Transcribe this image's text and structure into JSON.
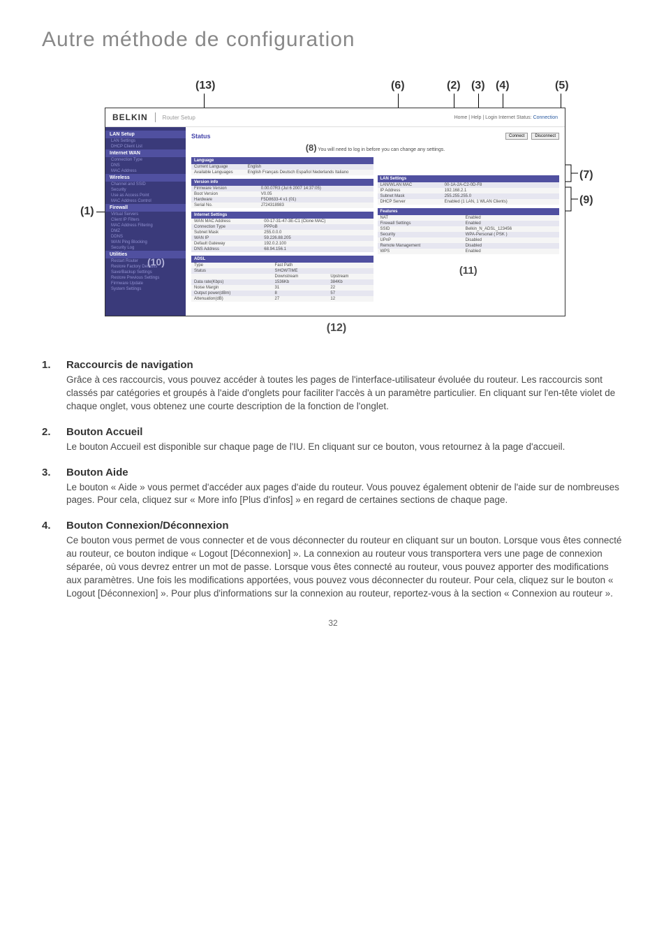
{
  "page_title": "Autre méthode de configuration",
  "callouts": {
    "c1": "(1)",
    "c2": "(2)",
    "c3": "(3)",
    "c4": "(4)",
    "c5": "(5)",
    "c6": "(6)",
    "c7": "(7)",
    "c8": "(8)",
    "c9": "(9)",
    "c10": "(10)",
    "c11": "(11)",
    "c12": "(12)",
    "c13": "(13)"
  },
  "router_ui": {
    "logo": "BELKIN",
    "setup_label": "Router Setup",
    "header_links": "Home | Help | Login   Internet Status:",
    "header_status": "Connection",
    "status_label": "Status",
    "connect_btn": "Connect",
    "disconnect_btn": "Disconnect",
    "login_note_prefix": "You will need to log in before you can change any settings.",
    "sidebar": {
      "lan_setup": "LAN Setup",
      "lan_settings": "LAN Settings",
      "dhcp_client_list": "DHCP Client List",
      "internet_wan": "Internet WAN",
      "connection_type": "Connection Type",
      "dns": "DNS",
      "mac_address": "MAC Address",
      "wireless": "Wireless",
      "channel_ssid": "Channel and SSID",
      "security": "Security",
      "use_as_ap": "Use as Access Point",
      "mac_addr_control": "MAC Address Control",
      "firewall": "Firewall",
      "virtual_servers": "Virtual Servers",
      "client_ip_filters": "Client IP Filters",
      "mac_addr_filtering": "MAC Address Filtering",
      "dmz": "DMZ",
      "ddns": "DDNS",
      "wan_ping_blocking": "WAN Ping Blocking",
      "security_log": "Security Log",
      "utilities": "Utilities",
      "restart_router": "Restart Router",
      "restore_factory": "Restore Factory Defaults",
      "save_backup": "Save/Backup Settings",
      "restore_previous": "Restore Previous Settings",
      "firmware_update": "Firmware Update",
      "system_settings": "System Settings"
    },
    "tables": {
      "language_hdr": "Language",
      "current_language_lbl": "Current Language",
      "current_language_val": "English",
      "available_languages_lbl": "Available Languages",
      "available_languages_val": "English Français Deutsch Español Nederlands Italiano",
      "version_hdr": "Version info",
      "firmware_version_lbl": "Firmware Version",
      "firmware_version_val": "0.00.07R3 (Jul 6 2007 14:37:05)",
      "boot_version_lbl": "Boot Version",
      "boot_version_val": "V0.05",
      "hardware_lbl": "Hardware",
      "hardware_val": "F5D8633-4 v1 (01)",
      "serial_lbl": "Serial No.",
      "serial_val": "J724318983",
      "internet_hdr": "Internet Settings",
      "wan_mac_lbl": "WAN MAC Address",
      "wan_mac_val": "00-17-31-47-3E-C1 (Clone MAC)",
      "connection_type_lbl": "Connection Type",
      "connection_type_val": "PPPoB",
      "subnet_mask_lbl": "Subnet Mask",
      "subnet_mask_val": "255.0.0.0",
      "wan_ip_lbl": "WAN IP",
      "wan_ip_val": "59.226.88.205",
      "default_gw_lbl": "Default Gateway",
      "default_gw_val": "192.0.2.100",
      "dns_addr_lbl": "DNS Address",
      "dns_addr_val": "68.94.156.1",
      "adsl_hdr": "ADSL",
      "adsl_type_lbl": "Type",
      "adsl_type_val": "Fast Path",
      "adsl_status_lbl": "Status",
      "adsl_status_val": "SHOWTIME",
      "adsl_downstream": "Downstream",
      "adsl_upstream": "Upstream",
      "data_rate_lbl": "Data rate(Kbps)",
      "data_rate_down": "1536Kb",
      "data_rate_up": "384Kb",
      "noise_lbl": "Noise Margin",
      "noise_down": "31",
      "noise_up": "22",
      "output_lbl": "Output power(dBm)",
      "output_down": "8",
      "output_up": "57",
      "atten_lbl": "Attenuation(dB)",
      "atten_down": "27",
      "atten_up": "12",
      "lan_hdr": "LAN Settings",
      "lanwlan_mac_lbl": "LAN/WLAN MAC",
      "lanwlan_mac_val": "00-1A-2A-C2-0D-F8",
      "ip_addr_lbl": "IP Address",
      "ip_addr_val": "192.168.2.1",
      "subnet2_lbl": "Subnet Mask",
      "subnet2_val": "255.255.255.0",
      "dhcp_server_lbl": "DHCP Server",
      "dhcp_server_val": "Enabled (1 LAN, 1 WLAN Clients)",
      "features_hdr": "Features",
      "nat_lbl": "NAT",
      "nat_val": "Enabled",
      "fw_settings_lbl": "Firewall Settings",
      "fw_settings_val": "Enabled",
      "ssid_lbl": "SSID",
      "ssid_val": "Belkin_N_ADSL_123456",
      "sec_lbl": "Security",
      "sec_val": "WPA-Personal ( PSK )",
      "upnp_lbl": "UPnP",
      "upnp_val": "Disabled",
      "remote_lbl": "Remote Management",
      "remote_val": "Disabled",
      "wps_lbl": "WPS",
      "wps_val": "Enabled"
    }
  },
  "sections": {
    "s1": {
      "num": "1.",
      "title": "Raccourcis de navigation",
      "text": "Grâce à ces raccourcis, vous pouvez accéder à toutes les pages de l'interface-utilisateur évoluée du routeur. Les raccourcis sont classés par catégories et groupés à l'aide d'onglets pour faciliter l'accès à un paramètre particulier. En cliquant sur l'en-tête violet de chaque onglet, vous obtenez une courte description de la fonction de l'onglet."
    },
    "s2": {
      "num": "2.",
      "title": "Bouton Accueil",
      "text": "Le bouton Accueil est disponible sur chaque page de l'IU. En cliquant sur ce bouton, vous retournez à la page d'accueil."
    },
    "s3": {
      "num": "3.",
      "title": "Bouton Aide",
      "text": "Le bouton « Aide » vous permet d'accéder aux pages d'aide du routeur. Vous pouvez également obtenir de l'aide sur de nombreuses pages. Pour cela, cliquez sur « More info [Plus d'infos] » en regard de certaines sections de chaque page."
    },
    "s4": {
      "num": "4.",
      "title": "Bouton Connexion/Déconnexion",
      "text": "Ce bouton vous permet de vous connecter et de vous déconnecter du routeur en cliquant sur un bouton. Lorsque vous êtes connecté au routeur, ce bouton indique « Logout [Déconnexion] ». La connexion au routeur vous transportera vers une page de connexion séparée, où vous devrez entrer un mot de passe. Lorsque vous êtes connecté au routeur, vous pouvez apporter des modifications aux paramètres. Une fois les modifications apportées, vous pouvez vous déconnecter du routeur. Pour cela, cliquez sur le bouton « Logout [Déconnexion] ». Pour plus d'informations sur la connexion au routeur, reportez-vous à la section « Connexion au routeur »."
    }
  },
  "page_number": "32"
}
